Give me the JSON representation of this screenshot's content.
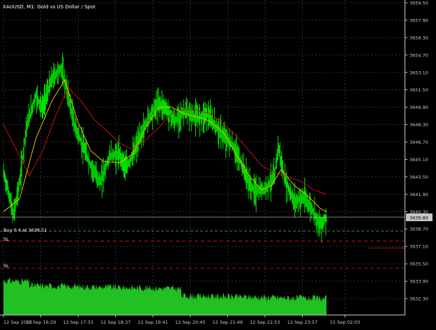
{
  "window": {
    "title": "XAUUSD, M1:  Gold vs US Dollar / Spot"
  },
  "colors": {
    "background": "#000000",
    "grid": "#3a3a3a",
    "axis_text": "#c8c8c8",
    "candles": "#00e000",
    "volume": "#22c022",
    "ma_fast": "#e6c200",
    "ma_slow": "#c81010",
    "sl_line": "#d01010",
    "price_line": "#b0b0b0",
    "last_price_bg": "#c8c8c8"
  },
  "orders": {
    "position_label": "Buy 0.4 at 3638.51",
    "sl_label_1": "SL",
    "sl_label_2": "SL"
  },
  "last_price": "3639.80",
  "chart_data": {
    "type": "line",
    "title": "XAUUSD, M1:  Gold vs US Dollar / Spot",
    "ylim": [
      3630.0,
      3659.5
    ],
    "y_ticks": [
      "3659.50",
      "3657.90",
      "3656.30",
      "3654.70",
      "3653.10",
      "3651.50",
      "3649.90",
      "3648.30",
      "3646.70",
      "3645.10",
      "3643.50",
      "3641.90",
      "3640.30",
      "3638.70",
      "3637.10",
      "3635.50",
      "3633.90",
      "3632.30"
    ],
    "x_ticks": [
      "12 Sep 2025",
      "12 Sep 16:29",
      "12 Sep 17:33",
      "12 Sep 18:37",
      "12 Sep 19:41",
      "12 Sep 20:45",
      "12 Sep 21:49",
      "12 Sep 22:53",
      "12 Sep 23:57",
      "15 Sep 02:03"
    ],
    "price_points": [
      [
        0,
        3643.9
      ],
      [
        0.02,
        3641.5
      ],
      [
        0.03,
        3639.9
      ],
      [
        0.05,
        3643.0
      ],
      [
        0.07,
        3648.0
      ],
      [
        0.1,
        3651.0
      ],
      [
        0.12,
        3649.8
      ],
      [
        0.15,
        3652.5
      ],
      [
        0.18,
        3653.5
      ],
      [
        0.2,
        3651.0
      ],
      [
        0.22,
        3648.2
      ],
      [
        0.25,
        3646.0
      ],
      [
        0.27,
        3644.5
      ],
      [
        0.3,
        3643.0
      ],
      [
        0.33,
        3645.5
      ],
      [
        0.36,
        3645.5
      ],
      [
        0.38,
        3644.3
      ],
      [
        0.4,
        3645.5
      ],
      [
        0.42,
        3646.9
      ],
      [
        0.45,
        3649.0
      ],
      [
        0.48,
        3650.3
      ],
      [
        0.5,
        3649.9
      ],
      [
        0.53,
        3648.6
      ],
      [
        0.56,
        3649.5
      ],
      [
        0.6,
        3648.9
      ],
      [
        0.63,
        3649.3
      ],
      [
        0.66,
        3648.0
      ],
      [
        0.68,
        3647.3
      ],
      [
        0.71,
        3646.4
      ],
      [
        0.74,
        3644.5
      ],
      [
        0.76,
        3642.9
      ],
      [
        0.78,
        3642.1
      ],
      [
        0.81,
        3642.4
      ],
      [
        0.84,
        3643.6
      ],
      [
        0.85,
        3646.4
      ],
      [
        0.87,
        3643.3
      ],
      [
        0.9,
        3641.2
      ],
      [
        0.93,
        3641.6
      ],
      [
        0.96,
        3640.3
      ],
      [
        0.98,
        3639.0
      ],
      [
        1.0,
        3639.8
      ]
    ],
    "ma_fast": [
      [
        0,
        3640.3
      ],
      [
        0.05,
        3641.5
      ],
      [
        0.1,
        3647.0
      ],
      [
        0.15,
        3650.5
      ],
      [
        0.19,
        3652.4
      ],
      [
        0.23,
        3648.6
      ],
      [
        0.27,
        3645.9
      ],
      [
        0.31,
        3644.9
      ],
      [
        0.36,
        3644.8
      ],
      [
        0.4,
        3645.6
      ],
      [
        0.44,
        3648.0
      ],
      [
        0.48,
        3649.9
      ],
      [
        0.52,
        3649.9
      ],
      [
        0.56,
        3649.3
      ],
      [
        0.6,
        3649.0
      ],
      [
        0.64,
        3648.6
      ],
      [
        0.68,
        3647.6
      ],
      [
        0.72,
        3645.6
      ],
      [
        0.76,
        3643.6
      ],
      [
        0.8,
        3642.3
      ],
      [
        0.83,
        3642.7
      ],
      [
        0.86,
        3644.2
      ],
      [
        0.9,
        3642.7
      ],
      [
        0.94,
        3641.8
      ],
      [
        0.98,
        3640.6
      ],
      [
        1.0,
        3640.3
      ]
    ],
    "ma_slow": [
      [
        0,
        3648.3
      ],
      [
        0.04,
        3646.0
      ],
      [
        0.08,
        3643.6
      ],
      [
        0.12,
        3645.8
      ],
      [
        0.16,
        3649.0
      ],
      [
        0.2,
        3651.7
      ],
      [
        0.24,
        3650.5
      ],
      [
        0.28,
        3648.8
      ],
      [
        0.32,
        3647.7
      ],
      [
        0.36,
        3646.6
      ],
      [
        0.4,
        3646.0
      ],
      [
        0.44,
        3646.9
      ],
      [
        0.48,
        3648.0
      ],
      [
        0.52,
        3649.3
      ],
      [
        0.56,
        3649.7
      ],
      [
        0.6,
        3649.6
      ],
      [
        0.64,
        3649.3
      ],
      [
        0.68,
        3648.4
      ],
      [
        0.72,
        3647.3
      ],
      [
        0.76,
        3645.9
      ],
      [
        0.8,
        3644.5
      ],
      [
        0.84,
        3643.9
      ],
      [
        0.88,
        3643.5
      ],
      [
        0.92,
        3643.1
      ],
      [
        0.96,
        3642.3
      ],
      [
        1.0,
        3641.9
      ]
    ],
    "price_line": 3639.8,
    "entry_price": 3638.51,
    "sl_price_1": 3637.6,
    "sl_price_2": 3635.1,
    "grid": true
  }
}
